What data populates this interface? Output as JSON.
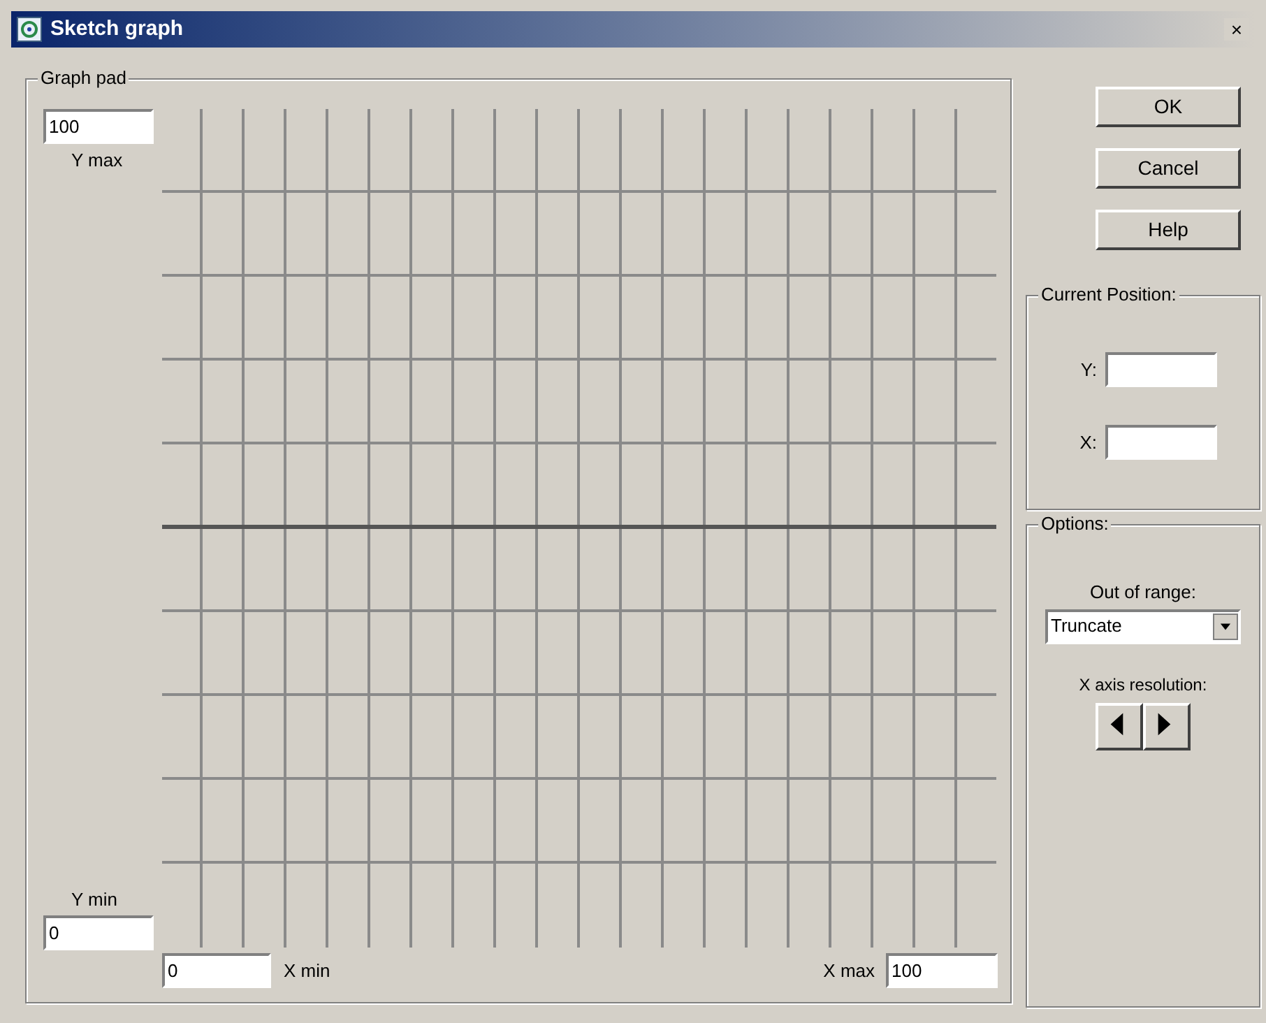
{
  "window": {
    "title": "Sketch graph",
    "close": "×"
  },
  "graph_pad": {
    "title": "Graph pad",
    "y_max": {
      "value": "100",
      "label": "Y max"
    },
    "y_min": {
      "value": "0",
      "label": "Y min"
    },
    "x_min": {
      "value": "0",
      "label": "X min"
    },
    "x_max": {
      "value": "100",
      "label": "X max"
    }
  },
  "buttons": [
    "OK",
    "Cancel",
    "Help"
  ],
  "current_position": {
    "title": "Current Position:",
    "fields": [
      {
        "label": "Y:"
      },
      {
        "label": "X:"
      }
    ]
  },
  "options": {
    "title": "Options:",
    "out_of_range": {
      "label": "Out of range:",
      "value": "Truncate"
    },
    "resolution": {
      "label": "X axis resolution:"
    }
  }
}
